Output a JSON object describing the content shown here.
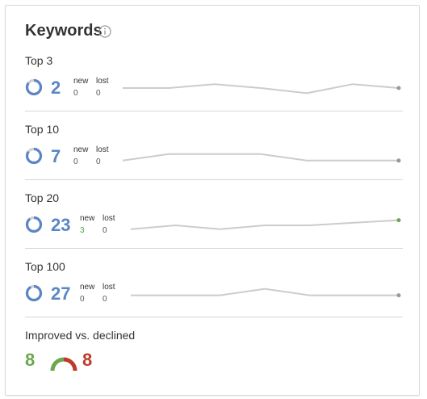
{
  "widget": {
    "title": "Keywords",
    "info_icon": "info-icon"
  },
  "sections": [
    {
      "label": "Top 3",
      "count": "2",
      "new_label": "new",
      "lost_label": "lost",
      "new_value": "0",
      "lost_value": "0",
      "ring_fill": 0.85,
      "trend": [
        0.5,
        0.5,
        0.2,
        0.5,
        0.9,
        0.2,
        0.5
      ],
      "end_dot_color": "#999999"
    },
    {
      "label": "Top 10",
      "count": "7",
      "new_label": "new",
      "lost_label": "lost",
      "new_value": "0",
      "lost_value": "0",
      "ring_fill": 0.85,
      "trend": [
        0.8,
        0.3,
        0.3,
        0.3,
        0.8,
        0.8,
        0.8
      ],
      "end_dot_color": "#999999"
    },
    {
      "label": "Top 20",
      "count": "23",
      "new_label": "new",
      "lost_label": "lost",
      "new_value": "3",
      "lost_value": "0",
      "ring_fill": 0.9,
      "trend": [
        0.8,
        0.5,
        0.8,
        0.5,
        0.5,
        0.3,
        0.1
      ],
      "end_dot_color": "#6aa84f"
    },
    {
      "label": "Top 100",
      "count": "27",
      "new_label": "new",
      "lost_label": "lost",
      "new_value": "0",
      "lost_value": "0",
      "ring_fill": 0.92,
      "trend": [
        0.6,
        0.6,
        0.6,
        0.1,
        0.6,
        0.6,
        0.6
      ],
      "end_dot_color": "#999999"
    }
  ],
  "summary": {
    "label": "Improved vs. declined",
    "improved": "8",
    "declined": "8",
    "improved_color": "#6aa84f",
    "declined_color": "#c0392b"
  },
  "colors": {
    "accent_blue": "#5b86c5",
    "ring_track": "#cfcfcf",
    "spark_line": "#cccccc",
    "new_positive": "#4ea14e"
  }
}
